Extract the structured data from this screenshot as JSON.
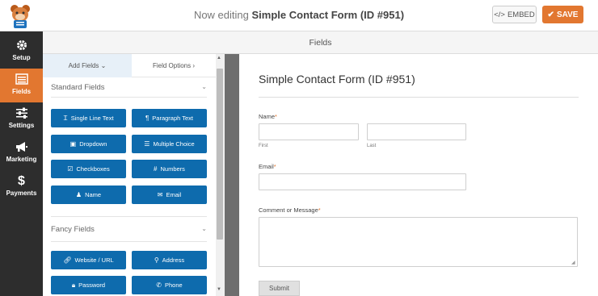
{
  "header": {
    "title_prefix": "Now editing",
    "form_name": "Simple Contact Form (ID #951)",
    "embed_label": "EMBED",
    "save_label": "SAVE"
  },
  "nav": [
    {
      "label": "Setup",
      "icon": "gear-icon"
    },
    {
      "label": "Fields",
      "icon": "list-icon"
    },
    {
      "label": "Settings",
      "icon": "sliders-icon"
    },
    {
      "label": "Marketing",
      "icon": "megaphone-icon"
    },
    {
      "label": "Payments",
      "icon": "dollar-icon"
    }
  ],
  "fields_header": "Fields",
  "tabs": {
    "add": "Add Fields",
    "options": "Field Options"
  },
  "standard_fields": {
    "title": "Standard Fields",
    "buttons": [
      "Single Line Text",
      "Paragraph Text",
      "Dropdown",
      "Multiple Choice",
      "Checkboxes",
      "Numbers",
      "Name",
      "Email"
    ]
  },
  "fancy_fields": {
    "title": "Fancy Fields",
    "buttons": [
      "Website / URL",
      "Address",
      "Password",
      "Phone"
    ]
  },
  "preview": {
    "title": "Simple Contact Form (ID #951)",
    "name_label": "Name",
    "first_sub": "First",
    "last_sub": "Last",
    "email_label": "Email",
    "message_label": "Comment or Message",
    "required_mark": "*",
    "submit_label": "Submit"
  },
  "colors": {
    "accent": "#e27730",
    "button_blue": "#0e6bad",
    "nav_bg": "#2d2d2d"
  }
}
